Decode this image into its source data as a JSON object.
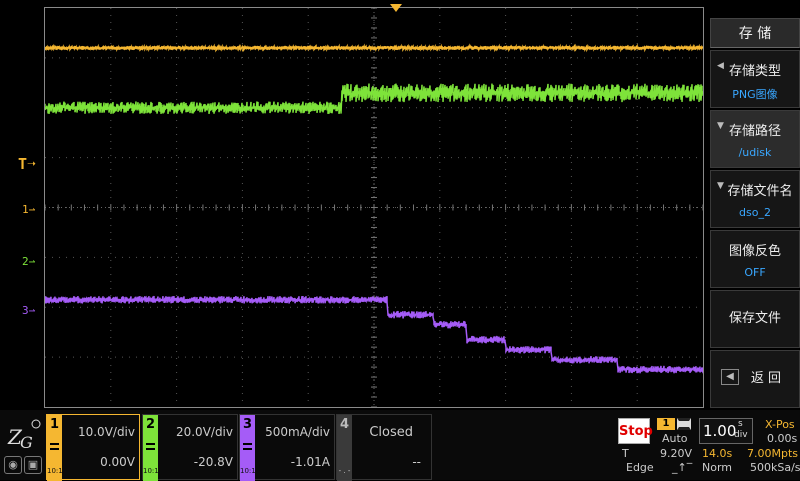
{
  "colors": {
    "ch1": "#f5b731",
    "ch2": "#7ee33a",
    "ch3": "#a55cf7",
    "ch4": "#3a3a3a",
    "trigger": "#f5b731",
    "accent": "#39a7ff",
    "stop": "#e00000"
  },
  "markers": {
    "trigger_level": "T",
    "ch1": "1",
    "ch2": "2",
    "ch3": "3"
  },
  "menu": {
    "title": "存 储",
    "items": [
      {
        "label": "存储类型",
        "value": "PNG图像"
      },
      {
        "label": "存储路径",
        "value": "/udisk"
      },
      {
        "label": "存储文件名",
        "value": "dso_2"
      },
      {
        "label": "图像反色",
        "value": "OFF"
      },
      {
        "label": "保存文件",
        "value": ""
      },
      {
        "label": "返 回",
        "value": ""
      }
    ]
  },
  "channels": [
    {
      "num": "1",
      "scale": "10.0V/div",
      "offset": "0.00V",
      "coupling": "10:1"
    },
    {
      "num": "2",
      "scale": "20.0V/div",
      "offset": "-20.8V",
      "coupling": "10:1"
    },
    {
      "num": "3",
      "scale": "500mA/div",
      "offset": "-1.01A",
      "coupling": "10:1"
    },
    {
      "num": "4",
      "scale": "Closed",
      "offset": "--",
      "coupling": "- . -"
    }
  ],
  "trigger": {
    "run_state": "Stop",
    "source": "1",
    "mode": "Auto",
    "level_label": "T",
    "level": "9.20V",
    "type": "Edge"
  },
  "timebase": {
    "scale": "1.00",
    "unit_top": "s",
    "unit_bottom": "div",
    "xpos_label": "X-Pos",
    "xpos": "0.00s",
    "window": "14.0s",
    "memory": "7.00Mpts",
    "acq_mode": "Norm",
    "sample_rate": "500kSa/s"
  },
  "waveforms": {
    "ch1": {
      "level_div": 3.2,
      "noise_div": 0.08
    },
    "ch2": {
      "level_start_div": 2.0,
      "level_end_div": 2.3,
      "noise_div": 0.25
    },
    "ch3": {
      "steps": [
        {
          "t_div": 0.0,
          "level_div": -1.85
        },
        {
          "t_div": 5.2,
          "level_div": -2.15
        },
        {
          "t_div": 5.9,
          "level_div": -2.35
        },
        {
          "t_div": 6.4,
          "level_div": -2.65
        },
        {
          "t_div": 7.0,
          "level_div": -2.85
        },
        {
          "t_div": 7.7,
          "level_div": -3.05
        },
        {
          "t_div": 8.7,
          "level_div": -3.25
        }
      ],
      "noise_div": 0.15
    }
  }
}
